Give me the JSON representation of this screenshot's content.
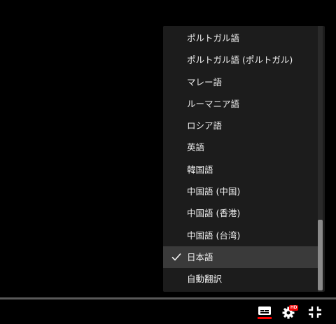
{
  "menu": {
    "items": [
      {
        "label": "ポルトガル語",
        "selected": false
      },
      {
        "label": "ポルトガル語 (ポルトガル)",
        "selected": false
      },
      {
        "label": "マレー語",
        "selected": false
      },
      {
        "label": "ルーマニア語",
        "selected": false
      },
      {
        "label": "ロシア語",
        "selected": false
      },
      {
        "label": "英語",
        "selected": false
      },
      {
        "label": "韓国語",
        "selected": false
      },
      {
        "label": "中国語 (中国)",
        "selected": false
      },
      {
        "label": "中国語 (香港)",
        "selected": false
      },
      {
        "label": "中国語 (台湾)",
        "selected": false
      },
      {
        "label": "日本語",
        "selected": true
      },
      {
        "label": "自動翻訳",
        "selected": false
      }
    ]
  },
  "controls": {
    "hd_badge": "HD",
    "icons": {
      "subtitles": "subtitles-icon",
      "settings": "settings-gear-icon",
      "exit_fullscreen": "exit-fullscreen-icon",
      "check": "check-icon"
    },
    "colors": {
      "accent": "#ff0000",
      "hd_badge": "#e00000"
    }
  }
}
